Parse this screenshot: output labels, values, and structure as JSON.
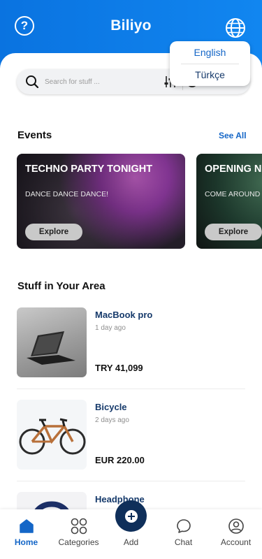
{
  "header": {
    "brand": "Biliyo",
    "help_icon": "question-icon",
    "globe_icon": "globe-icon",
    "colors": {
      "primary": "#0a73e0",
      "accent": "#1466c7",
      "navy": "#163a6b"
    }
  },
  "language_menu": {
    "options": [
      "English",
      "Türkçe"
    ]
  },
  "search": {
    "placeholder": "Search for stuff ...",
    "filter_icon": "sliders-icon",
    "location_icon": "location-icon"
  },
  "events": {
    "title": "Events",
    "see_all": "See All",
    "cards": [
      {
        "title": "TECHNO PARTY TONIGHT",
        "subtitle": "DANCE DANCE DANCE!",
        "button": "Explore"
      },
      {
        "title": "OPENING N",
        "subtitle": "COME AROUND",
        "button": "Explore"
      }
    ]
  },
  "area": {
    "title": "Stuff in Your Area",
    "items": [
      {
        "name": "MacBook pro",
        "age": "1 day ago",
        "price": "TRY 41,099"
      },
      {
        "name": "Bicycle",
        "age": "2 days ago",
        "price": "EUR 220.00"
      },
      {
        "name": "Headphone",
        "age": "",
        "price": ""
      }
    ]
  },
  "nav": {
    "items": [
      {
        "label": "Home",
        "icon": "home-icon"
      },
      {
        "label": "Categories",
        "icon": "grid-icon"
      },
      {
        "label": "Add",
        "icon": "plus-icon"
      },
      {
        "label": "Chat",
        "icon": "chat-icon"
      },
      {
        "label": "Account",
        "icon": "user-icon"
      }
    ]
  }
}
